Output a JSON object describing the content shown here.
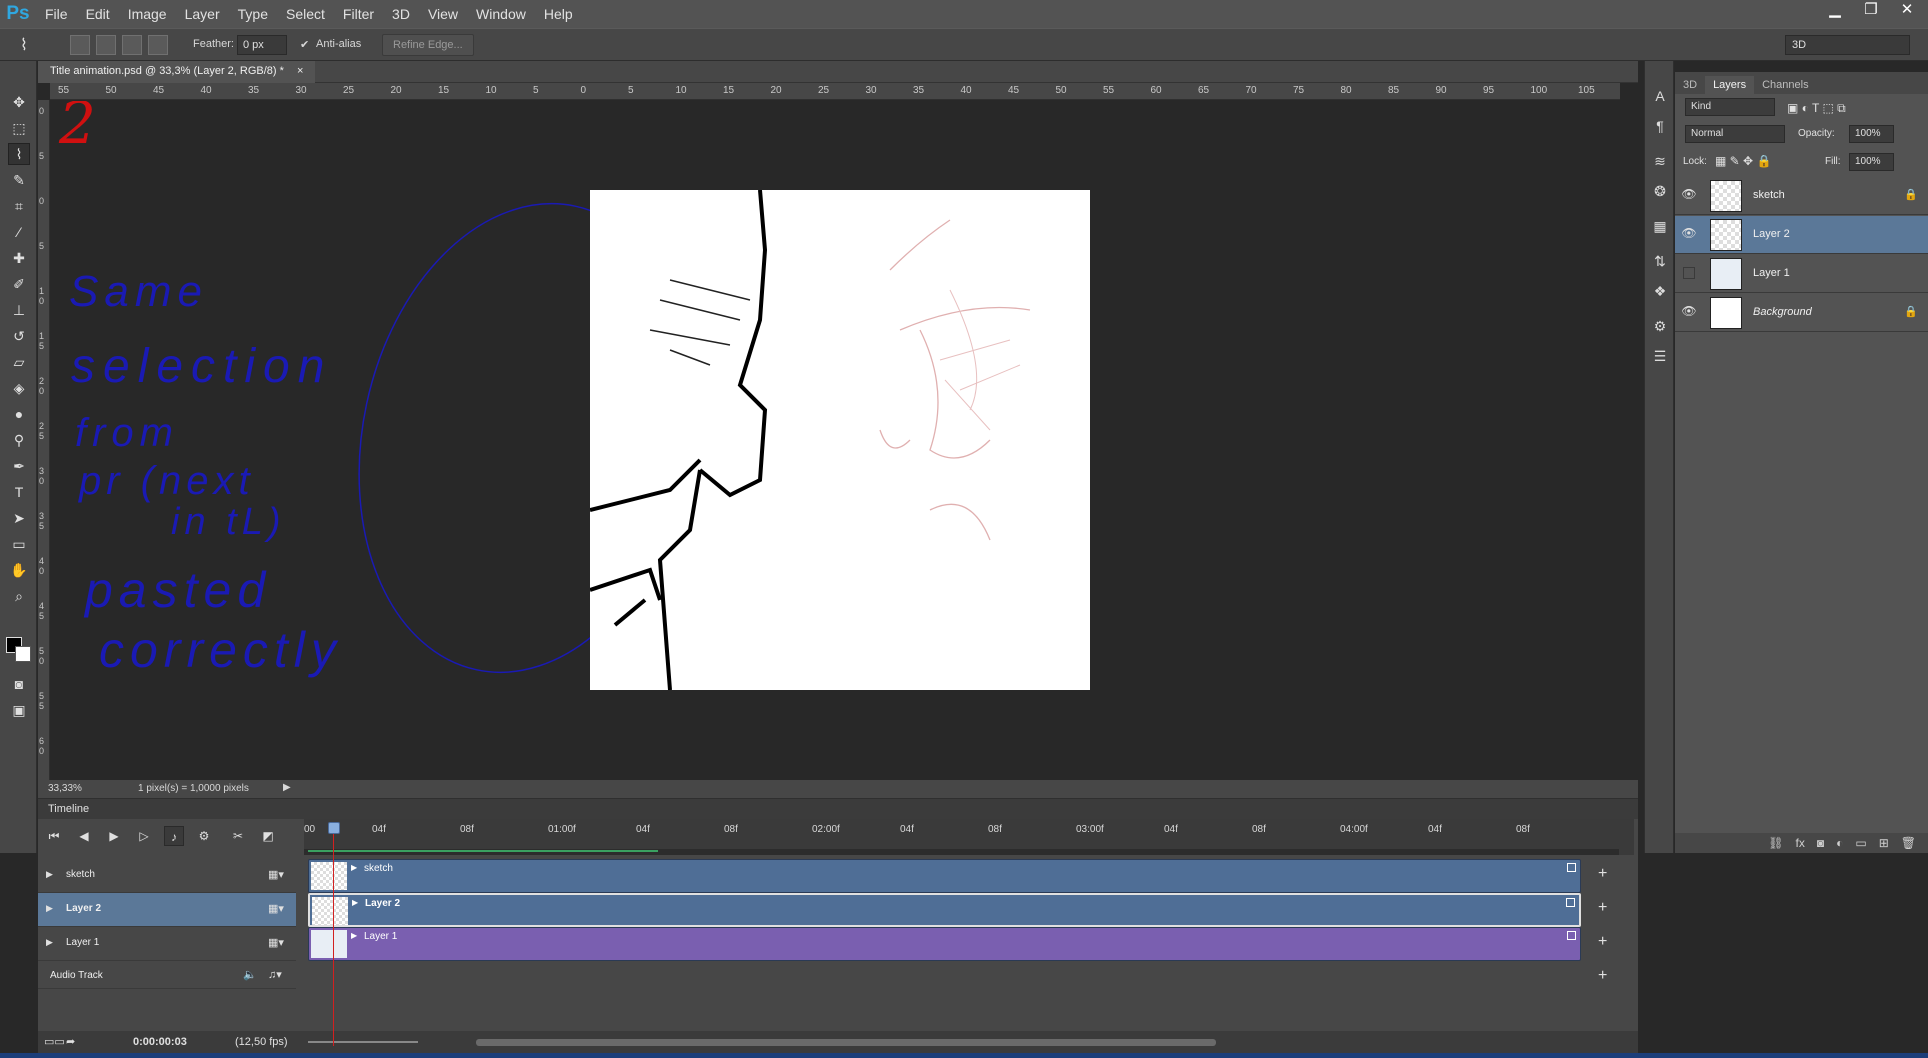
{
  "app": {
    "logo": "Ps"
  },
  "menu": [
    "File",
    "Edit",
    "Image",
    "Layer",
    "Type",
    "Select",
    "Filter",
    "3D",
    "View",
    "Window",
    "Help"
  ],
  "window_controls": {
    "minimize": "▁",
    "maximize": "❐",
    "close": "✕"
  },
  "options": {
    "feather_label": "Feather:",
    "feather_value": "0 px",
    "antialias_label": "Anti-alias",
    "antialias_checked": true,
    "refine_edge_label": "Refine Edge...",
    "workspace": "3D"
  },
  "document": {
    "tab_title": "Title animation.psd @ 33,3% (Layer 2, RGB/8) *",
    "close": "×"
  },
  "ruler_top": [
    "55",
    "50",
    "45",
    "40",
    "35",
    "30",
    "25",
    "20",
    "15",
    "10",
    "5",
    "0",
    "5",
    "10",
    "15",
    "20",
    "25",
    "30",
    "35",
    "40",
    "45",
    "50",
    "55",
    "60",
    "65",
    "70",
    "75",
    "80",
    "85",
    "90",
    "95",
    "100",
    "105"
  ],
  "ruler_left": [
    "0",
    "5",
    "0",
    "5",
    "1 0",
    "1 5",
    "2 0",
    "2 5",
    "3 0",
    "3 5",
    "4 0",
    "4 5",
    "5 0",
    "5 5",
    "6 0"
  ],
  "canvas_annotations": {
    "number": "2",
    "note_lines": [
      "Same",
      "selection",
      "from",
      "pr (next",
      "in tL)",
      "pasted",
      "correctly"
    ]
  },
  "status": {
    "zoom": "33,33%",
    "doc_info": "1 pixel(s) = 1,0000 pixels"
  },
  "panels": {
    "tabs": [
      "3D",
      "Layers",
      "Channels"
    ],
    "active_tab": "Layers",
    "kind_filter": "Kind",
    "blend_mode": "Normal",
    "opacity_label": "Opacity:",
    "opacity_value": "100%",
    "lock_label": "Lock:",
    "fill_label": "Fill:",
    "fill_value": "100%",
    "layers": [
      {
        "name": "sketch",
        "visible": true,
        "locked": true,
        "selected": false
      },
      {
        "name": "Layer 2",
        "visible": true,
        "locked": false,
        "selected": true
      },
      {
        "name": "Layer 1",
        "visible": false,
        "locked": false,
        "selected": false
      },
      {
        "name": "Background",
        "visible": true,
        "locked": true,
        "selected": false
      }
    ]
  },
  "timeline": {
    "title": "Timeline",
    "ruler": [
      "00",
      "04f",
      "08f",
      "01:00f",
      "04f",
      "08f",
      "02:00f",
      "04f",
      "08f",
      "03:00f",
      "04f",
      "08f",
      "04:00f",
      "04f",
      "08f"
    ],
    "tracks": [
      {
        "name": "sketch",
        "clip_label": "sketch",
        "color": "blue",
        "selected": false
      },
      {
        "name": "Layer 2",
        "clip_label": "Layer 2",
        "color": "blue",
        "selected": true
      },
      {
        "name": "Layer 1",
        "clip_label": "Layer 1",
        "color": "purple",
        "selected": false
      }
    ],
    "audio_track": "Audio Track",
    "current_time": "0:00:00:03",
    "fps": "(12,50 fps)"
  },
  "colors": {
    "accent": "#5b7898",
    "clip_blue": "#4f6e96",
    "clip_purple": "#7a5fb0",
    "playhead": "#d22020",
    "annotation_blue": "#1a1ab4",
    "annotation_red": "#d01010"
  }
}
